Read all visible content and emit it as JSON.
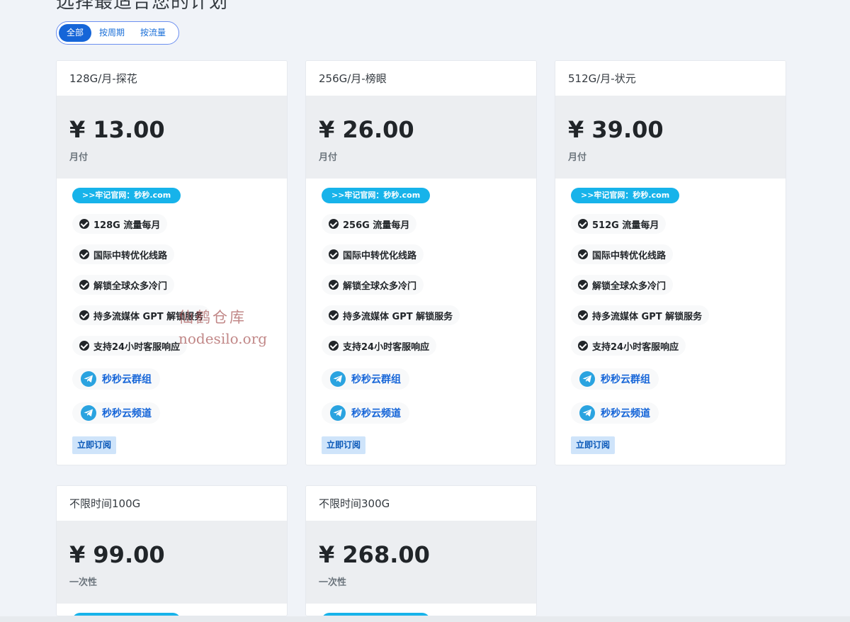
{
  "heading": "选择最适合您的计划",
  "filters": [
    {
      "label": "全部",
      "active": true
    },
    {
      "label": "按周期",
      "active": false
    },
    {
      "label": "按流量",
      "active": false
    }
  ],
  "site_badge": ">>牢记官网：秒秒.com",
  "links": {
    "group": "秒秒云群组",
    "channel": "秒秒云频道"
  },
  "subscribe_label": "立即订阅",
  "plans": [
    {
      "title": "128G/月-探花",
      "price": "¥ 13.00",
      "period": "月付",
      "features": [
        "128G 流量每月",
        "国际中转优化线路",
        "解锁全球众多冷门",
        "持多流媒体 GPT 解锁服务",
        "支持24小时客服响应"
      ]
    },
    {
      "title": "256G/月-榜眼",
      "price": "¥ 26.00",
      "period": "月付",
      "features": [
        "256G 流量每月",
        "国际中转优化线路",
        "解锁全球众多冷门",
        "持多流媒体 GPT 解锁服务",
        "支持24小时客服响应"
      ]
    },
    {
      "title": "512G/月-状元",
      "price": "¥ 39.00",
      "period": "月付",
      "features": [
        "512G 流量每月",
        "国际中转优化线路",
        "解锁全球众多冷门",
        "持多流媒体 GPT 解锁服务",
        "支持24小时客服响应"
      ]
    },
    {
      "title": "不限时间100G",
      "price": "¥ 99.00",
      "period": "一次性"
    },
    {
      "title": "不限时间300G",
      "price": "¥ 268.00",
      "period": "一次性"
    }
  ],
  "watermark": {
    "line1": "仙鹤仓库",
    "line2": "nodesilo.org"
  },
  "colors": {
    "accent": "#1565d8",
    "badge": "#17b3ea",
    "price_bg": "#eceef1",
    "page_bg": "#f0f3f8"
  }
}
